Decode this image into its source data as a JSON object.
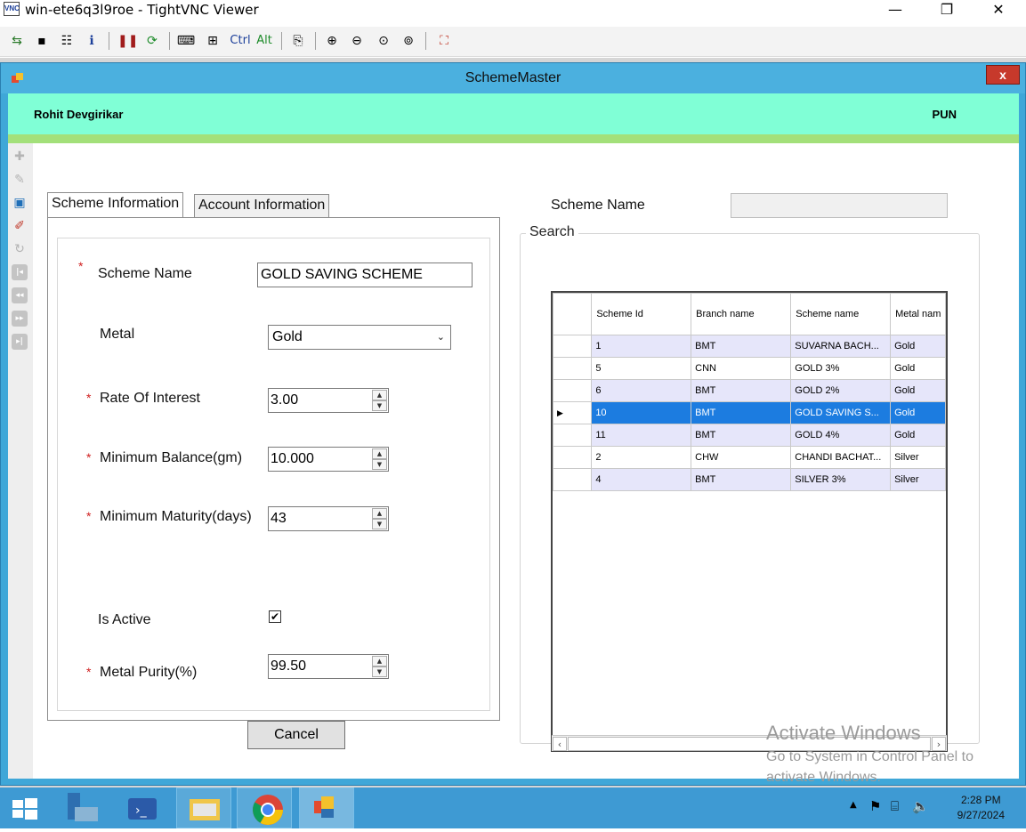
{
  "vnc": {
    "title": "win-ete6q3l9roe - TightVNC Viewer",
    "minimize": "—",
    "maximize": "❐",
    "close": "✕",
    "toolbar": {
      "ctrl": "Ctrl",
      "alt": "Alt"
    }
  },
  "window": {
    "title": "SchemeMaster",
    "close": "x"
  },
  "banner": {
    "user": "Rohit Devgirikar",
    "branch": "PUN"
  },
  "tabs": [
    {
      "label": "Scheme Information",
      "active": true
    },
    {
      "label": "Account Information",
      "active": false
    }
  ],
  "form": {
    "scheme_name": {
      "label": "Scheme Name",
      "value": "GOLD SAVING SCHEME",
      "required": true
    },
    "metal": {
      "label": "Metal",
      "value": "Gold"
    },
    "rate_of_interest": {
      "label": "Rate Of Interest",
      "value": "3.00",
      "required": true
    },
    "min_balance": {
      "label": "Minimum Balance(gm)",
      "value": "10.000",
      "required": true
    },
    "min_maturity": {
      "label": "Minimum Maturity(days)",
      "value": "43",
      "required": true
    },
    "is_active": {
      "label": "Is Active",
      "checked": true
    },
    "metal_purity": {
      "label": "Metal Purity(%)",
      "value": "99.50",
      "required": true
    },
    "required_mark": "*",
    "cancel_label": "Cancel"
  },
  "search": {
    "legend": "Search",
    "scheme_name_label": "Scheme Name",
    "scheme_name_value": ""
  },
  "grid": {
    "columns": [
      "Scheme Id",
      "Branch name",
      "Scheme name",
      "Metal nam"
    ],
    "rows": [
      [
        "1",
        "BMT",
        "SUVARNA BACH...",
        "Gold"
      ],
      [
        "5",
        "CNN",
        "GOLD 3%",
        "Gold"
      ],
      [
        "6",
        "BMT",
        "GOLD 2%",
        "Gold"
      ],
      [
        "10",
        "BMT",
        "GOLD SAVING S...",
        "Gold"
      ],
      [
        "11",
        "BMT",
        "GOLD 4%",
        "Gold"
      ],
      [
        "2",
        "CHW",
        "CHANDI BACHAT...",
        "Silver"
      ],
      [
        "4",
        "BMT",
        "SILVER 3%",
        "Silver"
      ]
    ],
    "selected_row_index": 3
  },
  "watermark": {
    "title": "Activate Windows",
    "line1": "Go to System in Control Panel to",
    "line2": "activate Windows."
  },
  "taskbar": {
    "time": "2:28 PM",
    "date": "9/27/2024"
  },
  "colors": {
    "banner": "#80ffd6",
    "strip": "#a3e07a",
    "selection": "#1c7ce0",
    "alt_row": "#e6e6fa",
    "window_frame": "#3fa7d8",
    "taskbar": "#3e9ad3"
  }
}
